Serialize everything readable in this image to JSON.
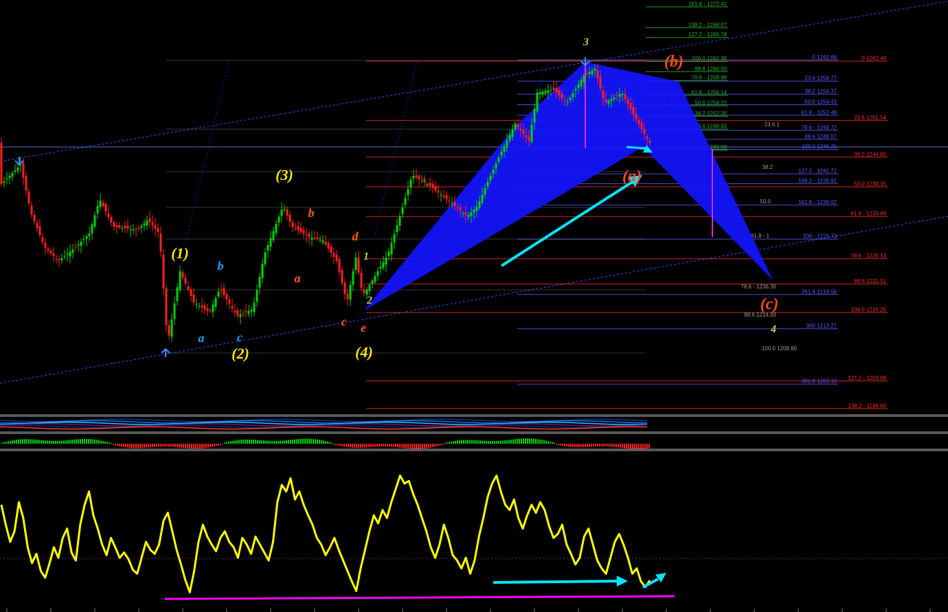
{
  "chart_data": {
    "type": "line",
    "title": "",
    "price_axis_range": [
      1195,
      1275
    ],
    "grid": false,
    "colors": {
      "background": "#000000",
      "candle_up": "#00d400",
      "candle_down": "#ff2020",
      "pattern_fill": "#1414ff",
      "oscillator": "#ffff00",
      "arrow": "#00e5ff",
      "support_line": "#ff00ff",
      "channel": "#3c50ff",
      "fib_red": "#ff2a2a",
      "fib_green": "#22b622",
      "fib_blue": "#5a5aff",
      "fib_gray": "#9a9a9a"
    },
    "pattern": "harmonic butterfly (blue triangles)",
    "fib_levels": {
      "upper_green": [
        {
          "label": "161.8 - 1272.41",
          "price": 1272.41
        },
        {
          "label": "138.2 - 1268.57",
          "price": 1268.57
        },
        {
          "label": "127.2 - 1266.78",
          "price": 1266.78
        },
        {
          "label": "100.0 1262.36",
          "price": 1262.36
        },
        {
          "label": "88.6 1260.50",
          "price": 1260.5
        },
        {
          "label": "78.6 - 1258.88",
          "price": 1258.88
        },
        {
          "label": "61.8 - 1256.14",
          "price": 1256.14
        },
        {
          "label": "50.0 1254.22",
          "price": 1254.22
        },
        {
          "label": "38.2 1252.30",
          "price": 1252.3
        },
        {
          "label": "23.6 1249.93",
          "price": 1249.93
        },
        {
          "label": "0 1246.09",
          "price": 1246.09
        }
      ],
      "blue": [
        {
          "label": "0 1262.66",
          "price": 1262.66
        },
        {
          "label": "23.6 1258.77",
          "price": 1258.77
        },
        {
          "label": "38.2 1256.37",
          "price": 1256.37
        },
        {
          "label": "50.0 1254.43",
          "price": 1254.43
        },
        {
          "label": "61.8 - 1252.48",
          "price": 1252.48
        },
        {
          "label": "78.6 - 1249.72",
          "price": 1249.72
        },
        {
          "label": "88.6 1248.07",
          "price": 1248.07
        },
        {
          "label": "100.0 1246.20",
          "price": 1246.2
        },
        {
          "label": "127.2 - 1241.72",
          "price": 1241.72
        },
        {
          "label": "138.2 - 1239.91",
          "price": 1239.91
        },
        {
          "label": "161.8 - 1236.02",
          "price": 1236.02
        },
        {
          "label": "200 - 1229.73",
          "price": 1229.73
        },
        {
          "label": "261.8 1219.56",
          "price": 1219.56
        },
        {
          "label": "300 1213.27",
          "price": 1213.27
        },
        {
          "label": "361.8 1203.10",
          "price": 1203.1
        }
      ],
      "red": [
        {
          "label": "0 1262.44",
          "price": 1262.44
        },
        {
          "label": "23.6 1251.54",
          "price": 1251.54
        },
        {
          "label": "38.2 1244.80",
          "price": 1244.8
        },
        {
          "label": "50.0 1239.35",
          "price": 1239.35
        },
        {
          "label": "61.8 - 1233.89",
          "price": 1233.89
        },
        {
          "label": "78.6 - 1226.13",
          "price": 1226.13
        },
        {
          "label": "88.6 1221.51",
          "price": 1221.51
        },
        {
          "label": "100.0 1216.25",
          "price": 1216.25
        },
        {
          "label": "127.2 - 1203.68",
          "price": 1203.68
        },
        {
          "label": "138.2 - 1198.60",
          "price": 1198.6
        }
      ],
      "gray_partial": [
        "23.6 1",
        "38.2",
        "50.0",
        "61.8 - 1",
        "78.6 - 1236.36",
        "88.6 1214.93",
        "100.0 1208.80"
      ]
    },
    "wave_labels": [
      {
        "text": "(1)",
        "color": "#ffe600"
      },
      {
        "text": "(2)",
        "color": "#ffe600"
      },
      {
        "text": "(3)",
        "color": "#ffe600"
      },
      {
        "text": "(4)",
        "color": "#ffe600"
      },
      {
        "text": "a",
        "color": "#1aa3ff"
      },
      {
        "text": "b",
        "color": "#1aa3ff"
      },
      {
        "text": "c",
        "color": "#1aa3ff"
      },
      {
        "text": "a",
        "color": "#ff5a1a"
      },
      {
        "text": "b",
        "color": "#ff5a1a"
      },
      {
        "text": "c",
        "color": "#ff5a1a"
      },
      {
        "text": "d",
        "color": "#ff5a1a"
      },
      {
        "text": "e",
        "color": "#ff5a1a"
      },
      {
        "text": "1",
        "color": "#b4d24b"
      },
      {
        "text": "2",
        "color": "#b4d24b"
      },
      {
        "text": "3",
        "color": "#b4d24b"
      },
      {
        "text": "4",
        "color": "#b4d24b"
      },
      {
        "text": "(a)",
        "color": "#ff4a1a"
      },
      {
        "text": "(b)",
        "color": "#ff4a1a"
      },
      {
        "text": "(c)",
        "color": "#ff4a1a"
      }
    ],
    "oscillator_series": [
      0.7,
      0.55,
      0.42,
      0.5,
      0.72,
      0.6,
      0.38,
      0.26,
      0.33,
      0.2,
      0.15,
      0.26,
      0.38,
      0.3,
      0.45,
      0.52,
      0.34,
      0.28,
      0.55,
      0.7,
      0.8,
      0.62,
      0.52,
      0.4,
      0.32,
      0.45,
      0.38,
      0.3,
      0.34,
      0.29,
      0.21,
      0.18,
      0.3,
      0.42,
      0.36,
      0.33,
      0.4,
      0.58,
      0.64,
      0.5,
      0.36,
      0.25,
      0.13,
      0.04,
      0.2,
      0.42,
      0.55,
      0.46,
      0.4,
      0.35,
      0.45,
      0.5,
      0.42,
      0.38,
      0.3,
      0.45,
      0.4,
      0.33,
      0.46,
      0.4,
      0.34,
      0.28,
      0.42,
      0.72,
      0.85,
      0.8,
      0.9,
      0.74,
      0.8,
      0.7,
      0.62,
      0.55,
      0.45,
      0.4,
      0.32,
      0.38,
      0.45,
      0.36,
      0.28,
      0.2,
      0.12,
      0.05,
      0.22,
      0.36,
      0.5,
      0.62,
      0.56,
      0.66,
      0.6,
      0.72,
      0.82,
      0.92,
      0.86,
      0.88,
      0.78,
      0.7,
      0.6,
      0.5,
      0.38,
      0.3,
      0.4,
      0.55,
      0.45,
      0.32,
      0.28,
      0.22,
      0.3,
      0.18,
      0.28,
      0.46,
      0.6,
      0.76,
      0.86,
      0.92,
      0.8,
      0.7,
      0.66,
      0.74,
      0.6,
      0.52,
      0.62,
      0.7,
      0.64,
      0.72,
      0.66,
      0.54,
      0.45,
      0.48,
      0.55,
      0.4,
      0.33,
      0.25,
      0.3,
      0.46,
      0.52,
      0.4,
      0.28,
      0.22,
      0.18,
      0.3,
      0.42,
      0.48,
      0.4,
      0.3,
      0.18,
      0.22,
      0.12,
      0.08,
      0.13
    ],
    "oscillator_annotation": "horizontal support line + cyan arrow",
    "histogram": "green/red sentiment bars"
  }
}
